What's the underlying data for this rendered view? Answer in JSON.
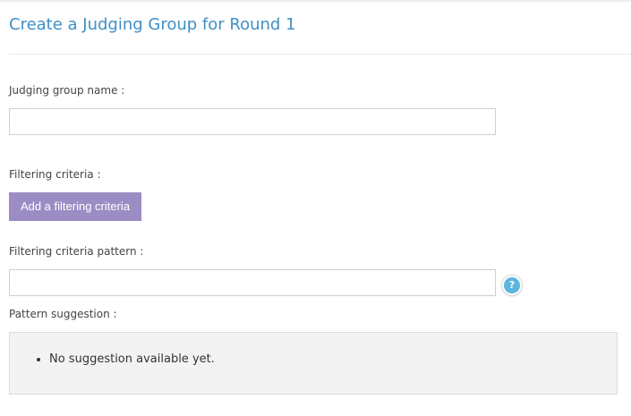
{
  "page": {
    "title": "Create a Judging Group for Round 1"
  },
  "form": {
    "group_name_label": "Judging group name :",
    "group_name_value": "",
    "filtering_label": "Filtering criteria :",
    "add_criteria_button": "Add a filtering criteria",
    "pattern_label": "Filtering criteria pattern :",
    "pattern_value": "",
    "help_icon_glyph": "?",
    "suggestion_label": "Pattern suggestion :",
    "suggestions": [
      "No suggestion available yet."
    ]
  },
  "colors": {
    "title": "#3f8fc6",
    "button": "#9b8dc4",
    "help_icon": "#5bb6de"
  },
  "icons": {
    "help": "help-icon"
  }
}
